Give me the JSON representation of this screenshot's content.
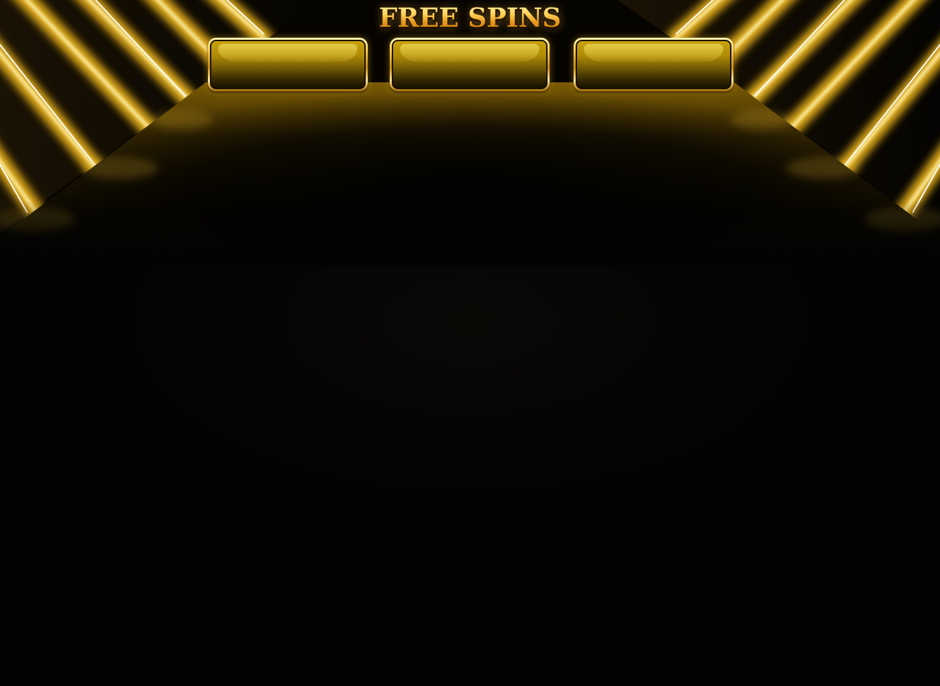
{
  "game": {
    "title": "FREE SPINS",
    "slots": [
      {
        "id": "slot-1",
        "value": ""
      },
      {
        "id": "slot-2",
        "value": ""
      },
      {
        "id": "slot-3",
        "value": ""
      }
    ]
  },
  "colors": {
    "gold_accent": "#f3b63a",
    "gold_frame": "#ffd45a",
    "slot_fill": "#b08c06",
    "background": "#030303",
    "neon_stripe": "#ffd23a"
  }
}
